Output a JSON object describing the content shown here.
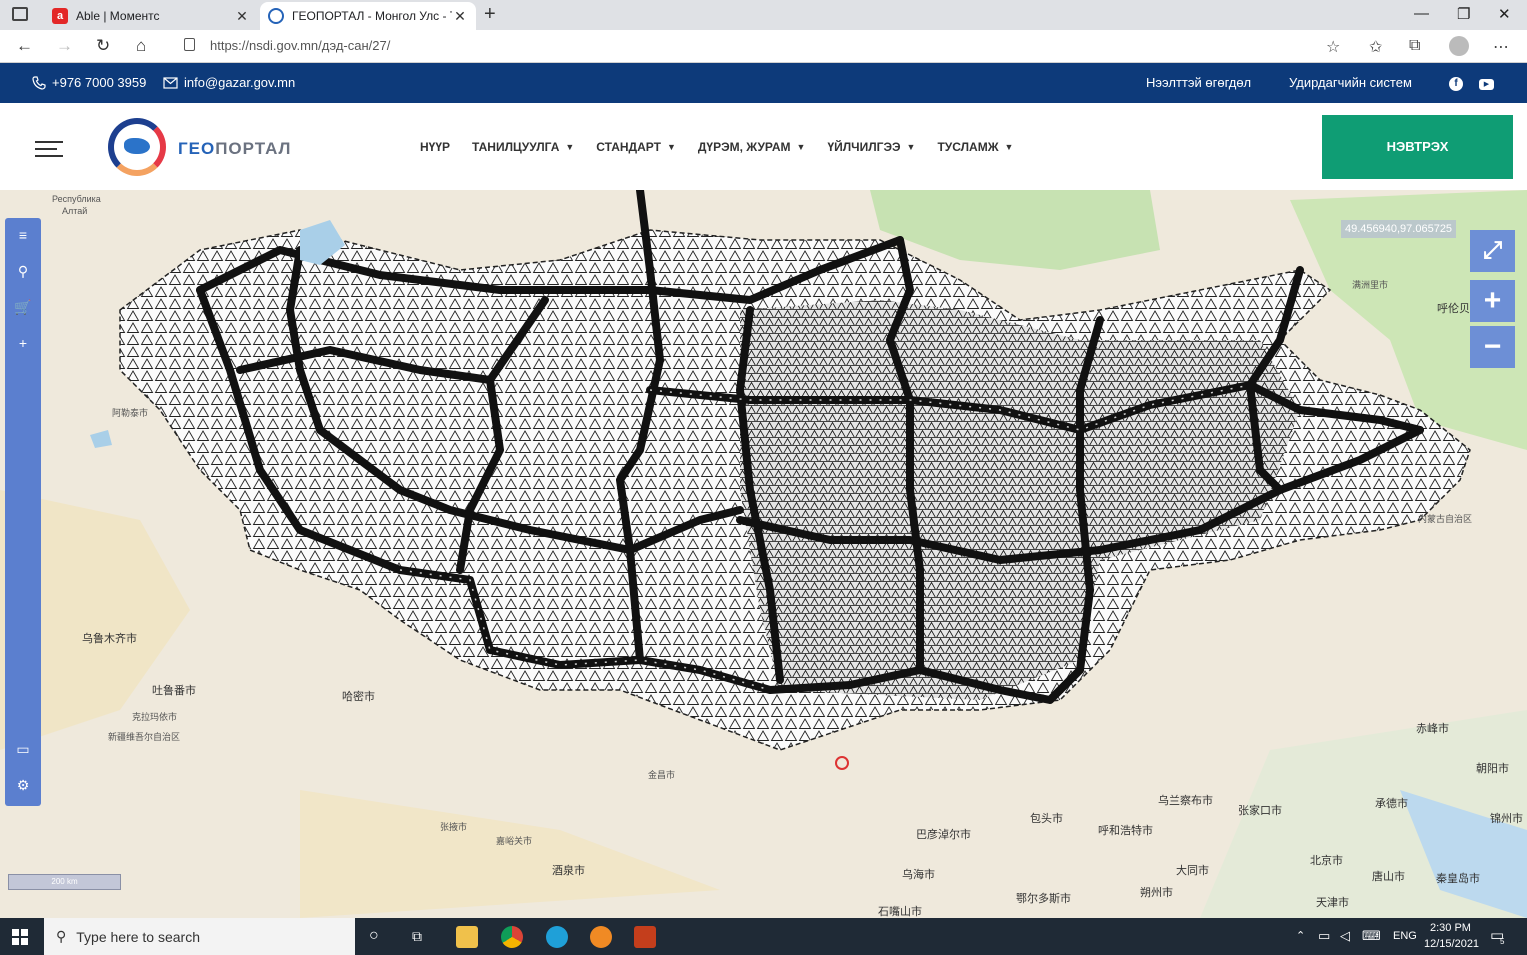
{
  "browser": {
    "tabs": [
      {
        "title": "Able | Моментс",
        "active": false
      },
      {
        "title": "ГЕОПОРТАЛ - Монгол Улс - Ту",
        "active": true
      }
    ],
    "url": "https://nsdi.gov.mn/дэд-сан/27/"
  },
  "topbar": {
    "phone": "+976 7000 3959",
    "email": "info@gazar.gov.mn",
    "link_open_data": "Нээлттэй өгөгдөл",
    "link_manager": "Удирдагчийн систем"
  },
  "nav": {
    "logo_prefix": "ГЕО",
    "logo_suffix": "ПОРТАЛ",
    "items": [
      {
        "label": "НҮҮР",
        "has_dropdown": false
      },
      {
        "label": "ТАНИЛЦУУЛГА",
        "has_dropdown": true
      },
      {
        "label": "СТАНДАРТ",
        "has_dropdown": true
      },
      {
        "label": "ДҮРЭМ, ЖУРАМ",
        "has_dropdown": true
      },
      {
        "label": "ҮЙЛЧИЛГЭЭ",
        "has_dropdown": true
      },
      {
        "label": "ТУСЛАМЖ",
        "has_dropdown": true
      }
    ],
    "login_label": "НЭВТРЭХ"
  },
  "map": {
    "coordinates": "49.456940,97.065725",
    "scale": "200 km",
    "labels": [
      {
        "text": "Республика"
      },
      {
        "text": "Алтай"
      },
      {
        "text": "乌鲁木齐市"
      },
      {
        "text": "吐鲁番市"
      },
      {
        "text": "哈密市"
      },
      {
        "text": "酒泉市"
      },
      {
        "text": "张掖市"
      },
      {
        "text": "包头市"
      },
      {
        "text": "呼和浩特市"
      },
      {
        "text": "乌兰察布市"
      },
      {
        "text": "张家口市"
      },
      {
        "text": "北京市"
      },
      {
        "text": "承德市"
      },
      {
        "text": "赤峰市"
      },
      {
        "text": "朝阳市"
      },
      {
        "text": "锦州市"
      },
      {
        "text": "巴彦淖尔市"
      },
      {
        "text": "鄂尔多斯市"
      },
      {
        "text": "乌海市"
      },
      {
        "text": "石嘴山市"
      },
      {
        "text": "大同市"
      },
      {
        "text": "朔州市"
      },
      {
        "text": "天津市"
      },
      {
        "text": "唐山市"
      },
      {
        "text": "秦皇岛市"
      },
      {
        "text": "满洲里市"
      },
      {
        "text": "呼伦贝"
      },
      {
        "text": "阿勒泰市"
      },
      {
        "text": "克拉玛依市"
      },
      {
        "text": "嘉峪关市"
      },
      {
        "text": "金昌市"
      },
      {
        "text": "内蒙古自治区"
      },
      {
        "text": "新疆维吾尔自治区"
      }
    ]
  },
  "taskbar": {
    "search_placeholder": "Type here to search",
    "lang": "ENG",
    "time": "2:30 PM",
    "date": "12/15/2021",
    "notification_count": "5"
  }
}
